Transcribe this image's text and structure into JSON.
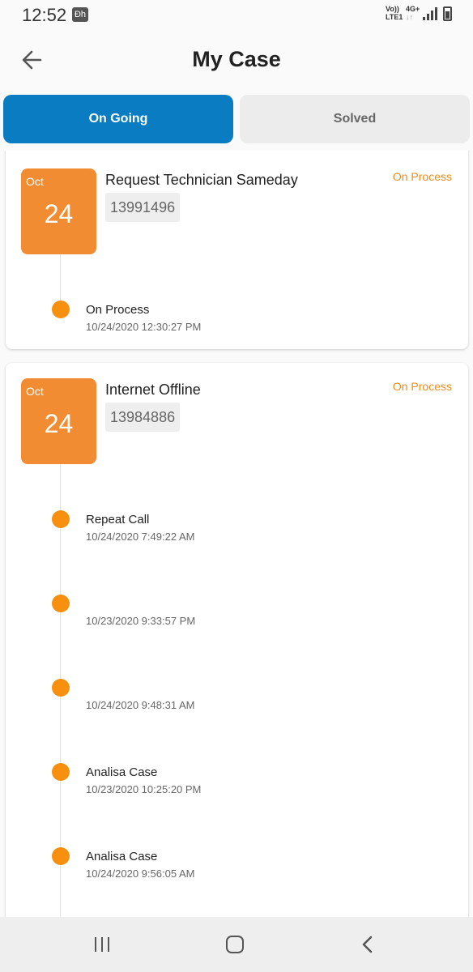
{
  "status_bar": {
    "time": "12:52",
    "app_icon": "Đh",
    "network_top": "Vo)) ",
    "network_bottom": "LTE1",
    "data_type": "4G+",
    "data_arrows": "↓↑"
  },
  "header": {
    "title": "My Case",
    "back_icon": "arrow-left-icon"
  },
  "tabs": [
    {
      "label": "On Going",
      "active": true
    },
    {
      "label": "Solved",
      "active": false
    }
  ],
  "colors": {
    "accent": "#0a7dc2",
    "date_box": "#f28c33",
    "status": "#f28c1a",
    "timeline_dot": "#f7900f"
  },
  "cases": [
    {
      "month": "Oct",
      "day": "24",
      "title": "Request Technician Sameday",
      "id": "13991496",
      "status": "On Process",
      "timeline": [
        {
          "label": "On Process",
          "time": "10/24/2020 12:30:27 PM"
        }
      ]
    },
    {
      "month": "Oct",
      "day": "24",
      "title": "Internet Offline",
      "id": "13984886",
      "status": "On Process",
      "timeline": [
        {
          "label": "Repeat Call",
          "time": "10/24/2020 7:49:22 AM"
        },
        {
          "label": "",
          "time": "10/23/2020 9:33:57 PM"
        },
        {
          "label": "",
          "time": "10/24/2020 9:48:31 AM"
        },
        {
          "label": "Analisa Case",
          "time": "10/23/2020 10:25:20 PM"
        },
        {
          "label": "Analisa Case",
          "time": "10/24/2020 9:56:05 AM"
        }
      ]
    }
  ],
  "nav_bar": {
    "recent_icon": "recent-apps-icon",
    "home_icon": "home-icon",
    "back_icon": "back-icon"
  }
}
